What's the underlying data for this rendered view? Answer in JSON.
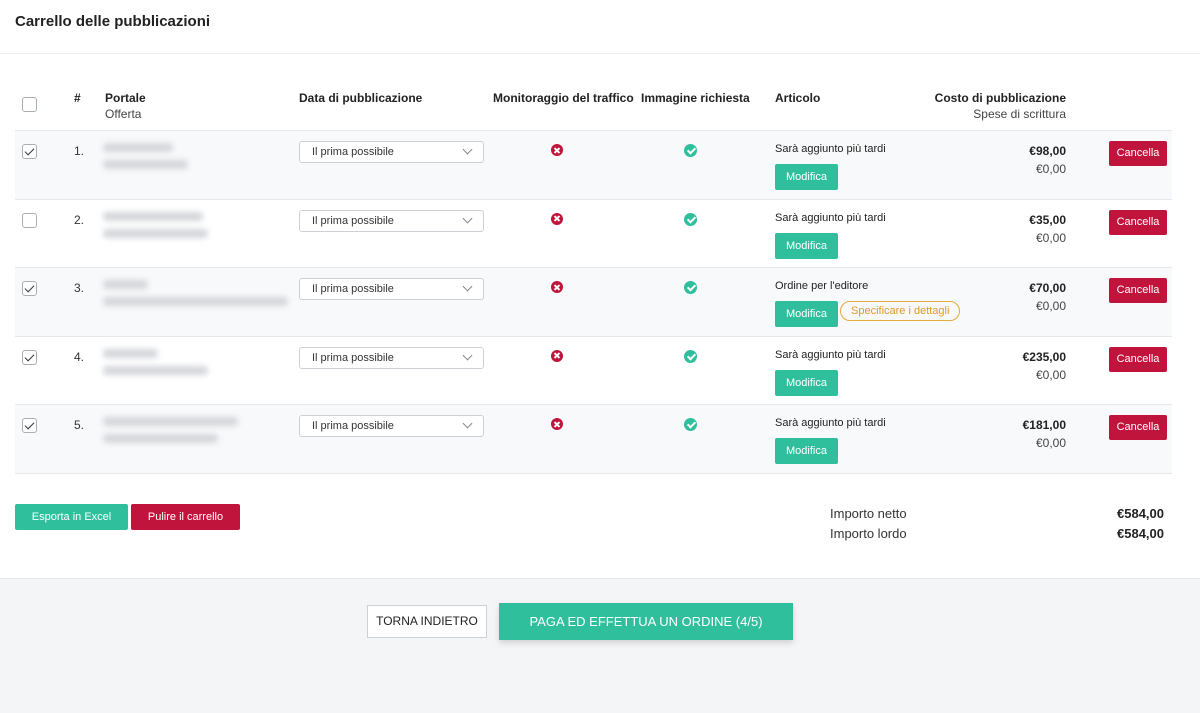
{
  "page": {
    "title": "Carrello delle pubblicazioni"
  },
  "table": {
    "headers": {
      "num": "#",
      "portal": "Portale",
      "portal_sub": "Offerta",
      "date": "Data di pubblicazione",
      "traffic": "Monitoraggio del traffico",
      "image": "Immagine richiesta",
      "article": "Articolo",
      "cost": "Costo di pubblicazione",
      "cost_sub": "Spese di scrittura"
    },
    "rows": [
      {
        "num": "1.",
        "checked": true,
        "date": "Il prima possibile",
        "article": "Sarà aggiunto più tardi",
        "edit": "Modifica",
        "price": "€98,00",
        "fee": "€0,00",
        "cancel": "Cancella"
      },
      {
        "num": "2.",
        "checked": false,
        "date": "Il prima possibile",
        "article": "Sarà aggiunto più tardi",
        "edit": "Modifica",
        "price": "€35,00",
        "fee": "€0,00",
        "cancel": "Cancella"
      },
      {
        "num": "3.",
        "checked": true,
        "date": "Il prima possibile",
        "article": "Ordine per l'editore",
        "edit": "Modifica",
        "details": "Specificare i dettagli",
        "price": "€70,00",
        "fee": "€0,00",
        "cancel": "Cancella"
      },
      {
        "num": "4.",
        "checked": true,
        "date": "Il prima possibile",
        "article": "Sarà aggiunto più tardi",
        "edit": "Modifica",
        "price": "€235,00",
        "fee": "€0,00",
        "cancel": "Cancella"
      },
      {
        "num": "5.",
        "checked": true,
        "date": "Il prima possibile",
        "article": "Sarà aggiunto più tardi",
        "edit": "Modifica",
        "price": "€181,00",
        "fee": "€0,00",
        "cancel": "Cancella"
      }
    ]
  },
  "actions": {
    "export": "Esporta in Excel",
    "clear": "Pulire il carrello"
  },
  "totals": {
    "net_label": "Importo netto",
    "net": "€584,00",
    "gross_label": "Importo lordo",
    "gross": "€584,00"
  },
  "footer": {
    "back": "TORNA INDIETRO",
    "pay": "PAGA ED EFFETTUA UN ORDINE (4/5)"
  },
  "colors": {
    "accent": "#2fbf9d",
    "danger": "#c0143c",
    "warning": "#e09a24"
  }
}
